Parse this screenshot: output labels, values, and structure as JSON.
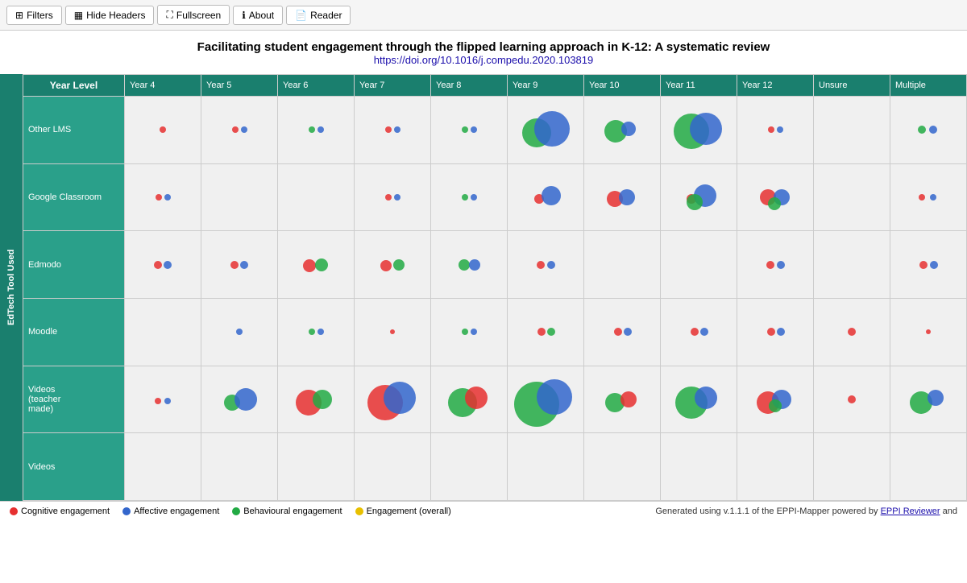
{
  "toolbar": {
    "filters_label": "Filters",
    "hide_headers_label": "Hide Headers",
    "fullscreen_label": "Fullscreen",
    "about_label": "About",
    "reader_label": "Reader"
  },
  "title": {
    "main": "Facilitating student engagement through the flipped learning approach in K-12: A systematic review",
    "doi": "https://doi.org/10.1016/j.compedu.2020.103819"
  },
  "table": {
    "top_header": "Year Level",
    "row_outer_label": "EdTech Tool Used",
    "columns": [
      "Year 4",
      "Year 5",
      "Year 6",
      "Year 7",
      "Year 8",
      "Year 9",
      "Year 10",
      "Year 11",
      "Year 12",
      "Unsure",
      "Multiple"
    ],
    "rows": [
      {
        "label": "Other LMS"
      },
      {
        "label": "Google Classroom"
      },
      {
        "label": "Edmodo"
      },
      {
        "label": "Moodle"
      },
      {
        "label": "Videos (teacher made)"
      },
      {
        "label": "Videos"
      }
    ]
  },
  "legend": {
    "items": [
      {
        "label": "Cognitive engagement",
        "color": "#e63030"
      },
      {
        "label": "Affective engagement",
        "color": "#3366cc"
      },
      {
        "label": "Behavioural engagement",
        "color": "#22aa44"
      },
      {
        "label": "Engagement (overall)",
        "color": "#e8c000"
      }
    ]
  },
  "footer": {
    "generated": "Generated using v.1.1.1 of the EPPI-Mapper powered by ",
    "link_text": "EPPI Reviewer",
    "link_url": "#",
    "suffix": " and"
  },
  "bubbles": {
    "rows": [
      {
        "cells": [
          [
            {
              "r": 4,
              "x": 50,
              "y": 50,
              "c": "#e63030"
            }
          ],
          [
            {
              "r": 4,
              "x": 45,
              "y": 50,
              "c": "#e63030"
            },
            {
              "r": 4,
              "x": 56,
              "y": 50,
              "c": "#3366cc"
            }
          ],
          [
            {
              "r": 4,
              "x": 45,
              "y": 50,
              "c": "#22aa44"
            },
            {
              "r": 4,
              "x": 56,
              "y": 50,
              "c": "#3366cc"
            }
          ],
          [
            {
              "r": 4,
              "x": 45,
              "y": 50,
              "c": "#e63030"
            },
            {
              "r": 4,
              "x": 56,
              "y": 50,
              "c": "#3366cc"
            }
          ],
          [
            {
              "r": 4,
              "x": 45,
              "y": 50,
              "c": "#22aa44"
            },
            {
              "r": 4,
              "x": 56,
              "y": 50,
              "c": "#3366cc"
            }
          ],
          [
            {
              "r": 18,
              "x": 38,
              "y": 55,
              "c": "#22aa44"
            },
            {
              "r": 22,
              "x": 58,
              "y": 48,
              "c": "#3366cc"
            }
          ],
          [
            {
              "r": 14,
              "x": 42,
              "y": 52,
              "c": "#22aa44"
            },
            {
              "r": 9,
              "x": 58,
              "y": 48,
              "c": "#3366cc"
            }
          ],
          [
            {
              "r": 22,
              "x": 40,
              "y": 52,
              "c": "#22aa44"
            },
            {
              "r": 20,
              "x": 60,
              "y": 48,
              "c": "#3366cc"
            }
          ],
          [
            {
              "r": 4,
              "x": 45,
              "y": 50,
              "c": "#e63030"
            },
            {
              "r": 4,
              "x": 56,
              "y": 50,
              "c": "#3366cc"
            }
          ],
          [],
          [
            {
              "r": 5,
              "x": 42,
              "y": 50,
              "c": "#22aa44"
            },
            {
              "r": 5,
              "x": 56,
              "y": 50,
              "c": "#3366cc"
            }
          ]
        ]
      },
      {
        "cells": [
          [
            {
              "r": 4,
              "x": 45,
              "y": 50,
              "c": "#e63030"
            },
            {
              "r": 4,
              "x": 56,
              "y": 50,
              "c": "#3366cc"
            }
          ],
          [],
          [],
          [
            {
              "r": 4,
              "x": 45,
              "y": 50,
              "c": "#e63030"
            },
            {
              "r": 4,
              "x": 56,
              "y": 50,
              "c": "#3366cc"
            }
          ],
          [
            {
              "r": 4,
              "x": 45,
              "y": 50,
              "c": "#22aa44"
            },
            {
              "r": 4,
              "x": 56,
              "y": 50,
              "c": "#3366cc"
            }
          ],
          [
            {
              "r": 6,
              "x": 42,
              "y": 52,
              "c": "#e63030"
            },
            {
              "r": 12,
              "x": 57,
              "y": 48,
              "c": "#3366cc"
            }
          ],
          [
            {
              "r": 10,
              "x": 40,
              "y": 52,
              "c": "#e63030"
            },
            {
              "r": 10,
              "x": 56,
              "y": 50,
              "c": "#3366cc"
            }
          ],
          [
            {
              "r": 6,
              "x": 40,
              "y": 52,
              "c": "#e63030"
            },
            {
              "r": 14,
              "x": 58,
              "y": 48,
              "c": "#3366cc"
            },
            {
              "r": 10,
              "x": 45,
              "y": 58,
              "c": "#22aa44"
            }
          ],
          [
            {
              "r": 10,
              "x": 40,
              "y": 50,
              "c": "#e63030"
            },
            {
              "r": 10,
              "x": 58,
              "y": 50,
              "c": "#3366cc"
            },
            {
              "r": 8,
              "x": 49,
              "y": 60,
              "c": "#22aa44"
            }
          ],
          [],
          [
            {
              "r": 4,
              "x": 42,
              "y": 50,
              "c": "#e63030"
            },
            {
              "r": 4,
              "x": 56,
              "y": 50,
              "c": "#3366cc"
            }
          ]
        ]
      },
      {
        "cells": [
          [
            {
              "r": 5,
              "x": 44,
              "y": 50,
              "c": "#e63030"
            },
            {
              "r": 5,
              "x": 56,
              "y": 50,
              "c": "#3366cc"
            }
          ],
          [
            {
              "r": 5,
              "x": 44,
              "y": 50,
              "c": "#e63030"
            },
            {
              "r": 5,
              "x": 56,
              "y": 50,
              "c": "#3366cc"
            }
          ],
          [
            {
              "r": 8,
              "x": 42,
              "y": 52,
              "c": "#e63030"
            },
            {
              "r": 8,
              "x": 57,
              "y": 50,
              "c": "#22aa44"
            }
          ],
          [
            {
              "r": 7,
              "x": 42,
              "y": 52,
              "c": "#e63030"
            },
            {
              "r": 7,
              "x": 58,
              "y": 50,
              "c": "#22aa44"
            }
          ],
          [
            {
              "r": 7,
              "x": 44,
              "y": 50,
              "c": "#22aa44"
            },
            {
              "r": 7,
              "x": 57,
              "y": 50,
              "c": "#3366cc"
            }
          ],
          [
            {
              "r": 5,
              "x": 44,
              "y": 50,
              "c": "#e63030"
            },
            {
              "r": 5,
              "x": 57,
              "y": 50,
              "c": "#3366cc"
            }
          ],
          [],
          [],
          [
            {
              "r": 5,
              "x": 44,
              "y": 50,
              "c": "#e63030"
            },
            {
              "r": 5,
              "x": 57,
              "y": 50,
              "c": "#3366cc"
            }
          ],
          [],
          [
            {
              "r": 5,
              "x": 44,
              "y": 50,
              "c": "#e63030"
            },
            {
              "r": 5,
              "x": 57,
              "y": 50,
              "c": "#3366cc"
            }
          ]
        ]
      },
      {
        "cells": [
          [],
          [
            {
              "r": 4,
              "x": 50,
              "y": 50,
              "c": "#3366cc"
            }
          ],
          [
            {
              "r": 4,
              "x": 45,
              "y": 50,
              "c": "#22aa44"
            },
            {
              "r": 4,
              "x": 56,
              "y": 50,
              "c": "#3366cc"
            }
          ],
          [
            {
              "r": 3,
              "x": 50,
              "y": 50,
              "c": "#e63030"
            }
          ],
          [
            {
              "r": 4,
              "x": 45,
              "y": 50,
              "c": "#22aa44"
            },
            {
              "r": 4,
              "x": 56,
              "y": 50,
              "c": "#3366cc"
            }
          ],
          [
            {
              "r": 5,
              "x": 45,
              "y": 50,
              "c": "#e63030"
            },
            {
              "r": 5,
              "x": 57,
              "y": 50,
              "c": "#22aa44"
            }
          ],
          [
            {
              "r": 5,
              "x": 45,
              "y": 50,
              "c": "#e63030"
            },
            {
              "r": 5,
              "x": 57,
              "y": 50,
              "c": "#3366cc"
            }
          ],
          [
            {
              "r": 5,
              "x": 45,
              "y": 50,
              "c": "#e63030"
            },
            {
              "r": 5,
              "x": 57,
              "y": 50,
              "c": "#3366cc"
            }
          ],
          [
            {
              "r": 5,
              "x": 45,
              "y": 50,
              "c": "#e63030"
            },
            {
              "r": 5,
              "x": 57,
              "y": 50,
              "c": "#3366cc"
            }
          ],
          [
            {
              "r": 5,
              "x": 50,
              "y": 50,
              "c": "#e63030"
            }
          ],
          [
            {
              "r": 3,
              "x": 50,
              "y": 50,
              "c": "#e63030"
            }
          ]
        ]
      },
      {
        "cells": [
          [
            {
              "r": 4,
              "x": 44,
              "y": 52,
              "c": "#e63030"
            },
            {
              "r": 4,
              "x": 56,
              "y": 52,
              "c": "#3366cc"
            }
          ],
          [
            {
              "r": 10,
              "x": 40,
              "y": 55,
              "c": "#22aa44"
            },
            {
              "r": 14,
              "x": 58,
              "y": 50,
              "c": "#3366cc"
            }
          ],
          [
            {
              "r": 16,
              "x": 40,
              "y": 55,
              "c": "#e63030"
            },
            {
              "r": 12,
              "x": 58,
              "y": 50,
              "c": "#22aa44"
            }
          ],
          [
            {
              "r": 22,
              "x": 40,
              "y": 55,
              "c": "#e63030"
            },
            {
              "r": 20,
              "x": 60,
              "y": 48,
              "c": "#3366cc"
            }
          ],
          [
            {
              "r": 18,
              "x": 42,
              "y": 55,
              "c": "#22aa44"
            },
            {
              "r": 14,
              "x": 60,
              "y": 48,
              "c": "#e63030"
            }
          ],
          [
            {
              "r": 28,
              "x": 38,
              "y": 58,
              "c": "#22aa44"
            },
            {
              "r": 22,
              "x": 62,
              "y": 46,
              "c": "#3366cc"
            }
          ],
          [
            {
              "r": 12,
              "x": 40,
              "y": 55,
              "c": "#22aa44"
            },
            {
              "r": 10,
              "x": 58,
              "y": 50,
              "c": "#e63030"
            }
          ],
          [
            {
              "r": 20,
              "x": 40,
              "y": 55,
              "c": "#22aa44"
            },
            {
              "r": 14,
              "x": 60,
              "y": 48,
              "c": "#3366cc"
            }
          ],
          [
            {
              "r": 14,
              "x": 40,
              "y": 55,
              "c": "#e63030"
            },
            {
              "r": 12,
              "x": 58,
              "y": 50,
              "c": "#3366cc"
            },
            {
              "r": 8,
              "x": 50,
              "y": 60,
              "c": "#22aa44"
            }
          ],
          [
            {
              "r": 5,
              "x": 50,
              "y": 50,
              "c": "#e63030"
            }
          ],
          [
            {
              "r": 14,
              "x": 40,
              "y": 55,
              "c": "#22aa44"
            },
            {
              "r": 10,
              "x": 60,
              "y": 48,
              "c": "#3366cc"
            }
          ]
        ]
      },
      {
        "cells": [
          [],
          [],
          [],
          [],
          [],
          [],
          [],
          [],
          [],
          [],
          []
        ]
      }
    ]
  }
}
